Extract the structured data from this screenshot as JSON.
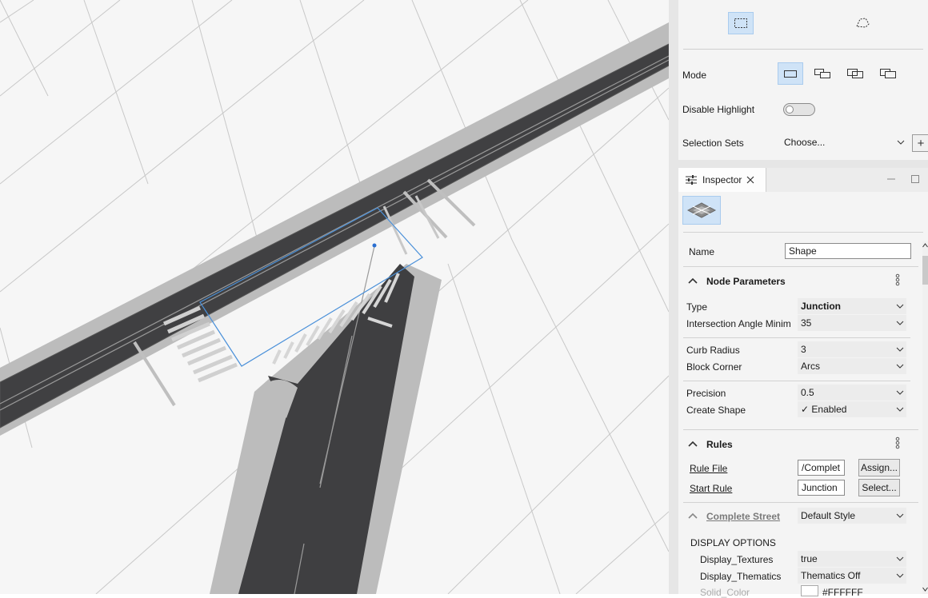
{
  "selection_panel": {
    "mode_label": "Mode",
    "disable_highlight_label": "Disable Highlight",
    "disable_highlight_on": false,
    "selection_sets_label": "Selection Sets",
    "selection_sets_value": "Choose...",
    "add_button_label": "+",
    "tools": [
      "rectangle-select-icon",
      "lasso-select-icon"
    ],
    "modes": [
      "mode-replace-icon",
      "mode-add-icon",
      "mode-intersect-icon",
      "mode-subtract-icon"
    ]
  },
  "inspector": {
    "tab_label": "Inspector",
    "name_label": "Name",
    "name_value": "Shape",
    "node_params_title": "Node Parameters",
    "type_label": "Type",
    "type_value": "Junction",
    "angle_label": "Intersection Angle Minim",
    "angle_value": "35",
    "curb_label": "Curb Radius",
    "curb_value": "3",
    "block_label": "Block Corner",
    "block_value": "Arcs",
    "precision_label": "Precision",
    "precision_value": "0.5",
    "create_label": "Create Shape",
    "create_value": "✓ Enabled",
    "rules_title": "Rules",
    "rule_file_label": "Rule File",
    "rule_file_value": "/Complet",
    "assign_button": "Assign...",
    "start_rule_label": "Start Rule",
    "start_rule_value": "Junction",
    "select_button": "Select...",
    "complete_street_label": "Complete Street",
    "style_value": "Default Style",
    "display_options_label": "DISPLAY OPTIONS",
    "display_textures_label": "Display_Textures",
    "display_textures_value": "true",
    "display_thematics_label": "Display_Thematics",
    "display_thematics_value": "Thematics Off",
    "solid_color_label": "Solid_Color",
    "solid_color_value": "#FFFFFF"
  },
  "colors": {
    "accent": "#cfe3f7",
    "selection_outline": "#4a90d9",
    "road": "#3f3f41",
    "sidewalk": "#bdbdbd"
  }
}
